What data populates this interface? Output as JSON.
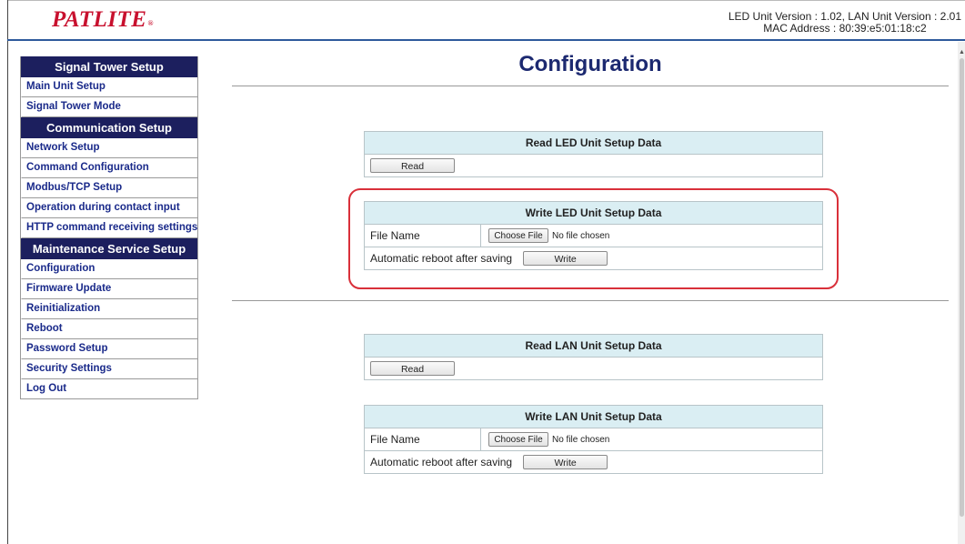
{
  "header": {
    "logo_text": "PATLITE",
    "logo_mark": "®",
    "version_line1": "LED Unit Version : 1.02, LAN Unit Version : 2.01",
    "version_line2": "MAC Address : 80:39:e5:01:18:c2"
  },
  "sidebar": {
    "sections": [
      {
        "title": "Signal Tower Setup",
        "items": [
          "Main Unit Setup",
          "Signal Tower Mode"
        ]
      },
      {
        "title": "Communication Setup",
        "items": [
          "Network Setup",
          "Command Configuration",
          "Modbus/TCP Setup",
          "Operation during contact input",
          "HTTP command receiving settings"
        ]
      },
      {
        "title": "Maintenance Service Setup",
        "items": [
          "Configuration",
          "Firmware Update",
          "Reinitialization",
          "Reboot",
          "Password Setup",
          "Security Settings",
          "Log Out"
        ]
      }
    ]
  },
  "main": {
    "title": "Configuration",
    "read_led": {
      "heading": "Read LED Unit Setup Data",
      "button": "Read"
    },
    "write_led": {
      "heading": "Write LED Unit Setup Data",
      "file_label": "File Name",
      "file_button": "Choose File",
      "file_status": "No file chosen",
      "reboot_label": "Automatic reboot after saving",
      "button": "Write"
    },
    "read_lan": {
      "heading": "Read LAN Unit Setup Data",
      "button": "Read"
    },
    "write_lan": {
      "heading": "Write LAN Unit Setup Data",
      "file_label": "File Name",
      "file_button": "Choose File",
      "file_status": "No file chosen",
      "reboot_label": "Automatic reboot after saving",
      "button": "Write"
    }
  },
  "colors": {
    "brand_red": "#c8102e",
    "nav_header": "#1c1f5e",
    "nav_link": "#1a2a8a",
    "panel_header": "#daeef3",
    "highlight": "#d9303a"
  }
}
